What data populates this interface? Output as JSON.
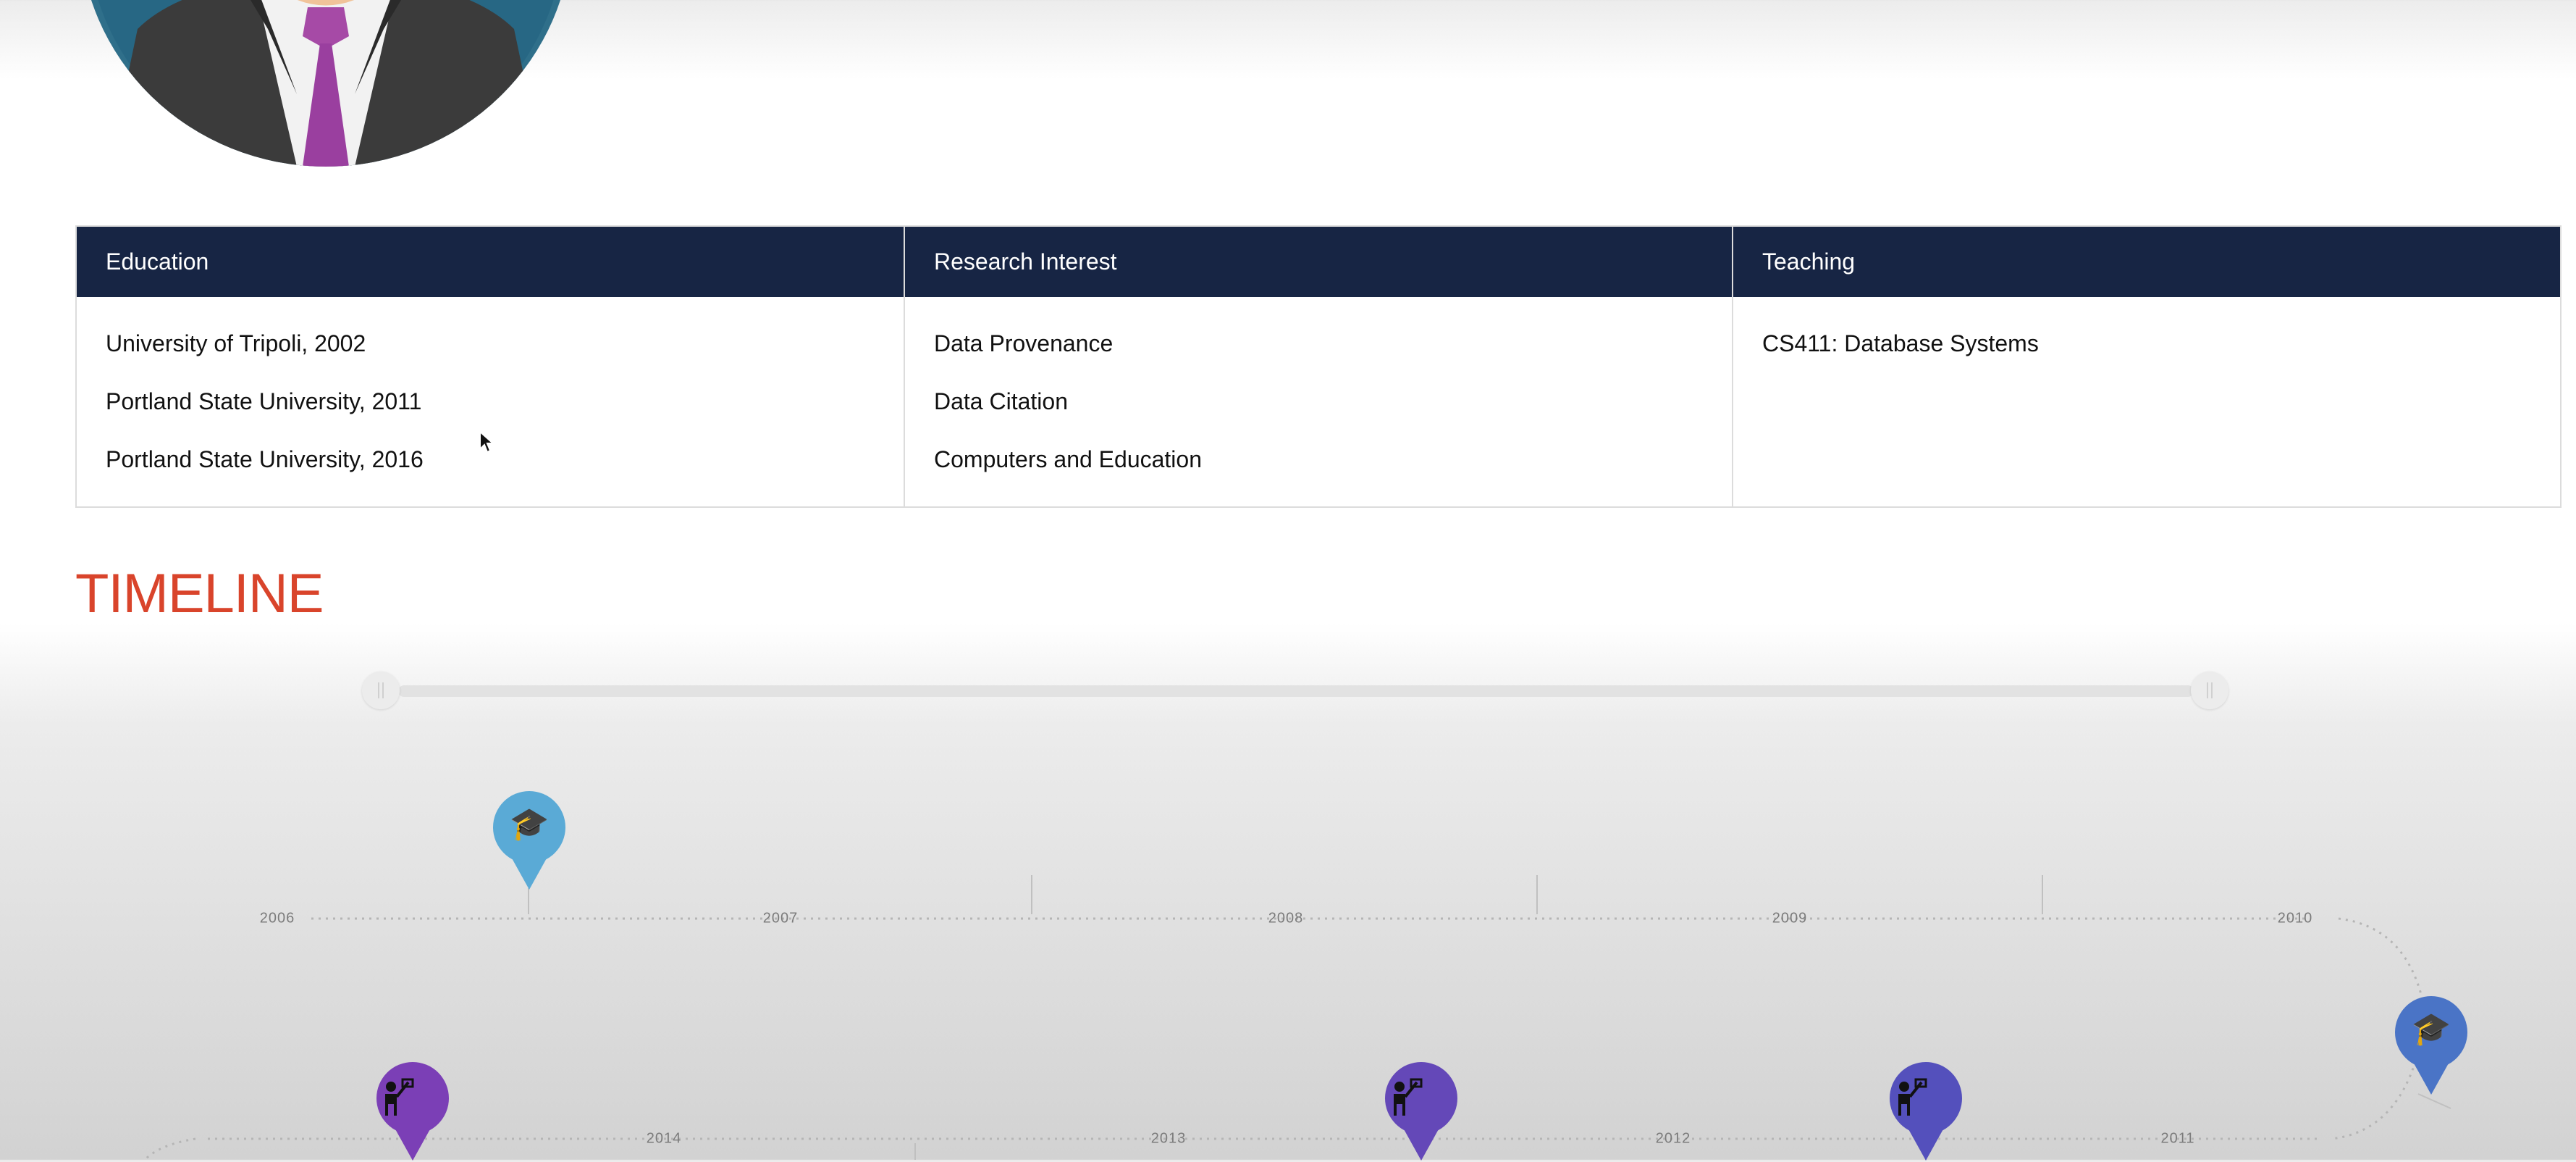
{
  "table": {
    "columns": [
      {
        "header": "Education",
        "items": [
          "University of Tripoli, 2002",
          "Portland State University, 2011",
          "Portland State University, 2016"
        ]
      },
      {
        "header": "Research Interest",
        "items": [
          "Data Provenance",
          "Data Citation",
          "Computers and Education"
        ]
      },
      {
        "header": "Teaching",
        "items": [
          "CS411: Database Systems"
        ]
      }
    ]
  },
  "timeline": {
    "title": "TIMELINE",
    "years_top": [
      "2006",
      "2007",
      "2008",
      "2009",
      "2010"
    ],
    "years_bottom": [
      "2014",
      "2013",
      "2012",
      "2011"
    ],
    "markers": [
      {
        "type": "graduation",
        "icon": "graduation-cap-icon",
        "color": "#5aaad6"
      },
      {
        "type": "graduation",
        "icon": "graduation-cap-icon",
        "color": "#4a74c6"
      },
      {
        "type": "teaching",
        "icon": "teacher-icon",
        "color": "#7b3fb6"
      },
      {
        "type": "teaching",
        "icon": "teacher-icon",
        "color": "#6448b8"
      },
      {
        "type": "teaching",
        "icon": "teacher-icon",
        "color": "#5450bc"
      }
    ]
  },
  "colors": {
    "header_bg": "#172544",
    "timeline_title": "#d9442b"
  }
}
